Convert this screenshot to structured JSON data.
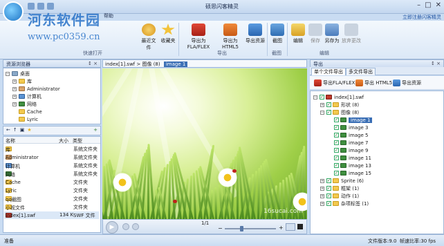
{
  "app": {
    "title": "硕思闪客精灵",
    "menu_text": "帮助",
    "register_link": "立即注册闪客精灵",
    "window_controls": [
      "–",
      "□",
      "✕"
    ]
  },
  "watermark": {
    "line1": "河东软件园",
    "line2": "www.pc0359.cn"
  },
  "ribbon": {
    "groups": [
      {
        "label": "快速打开",
        "buttons": [
          {
            "label": "最近文件"
          },
          {
            "label": "收藏夹"
          }
        ]
      },
      {
        "label": "导出",
        "buttons": [
          {
            "label": "导出为FLA/FLEX"
          },
          {
            "label": "导出为HTML5"
          },
          {
            "label": "导出资源"
          }
        ]
      },
      {
        "label": "截图",
        "buttons": [
          {
            "label": "截图"
          }
        ]
      },
      {
        "label": "编辑",
        "buttons": [
          {
            "label": "编辑"
          },
          {
            "label": "保存"
          },
          {
            "label": "另存为"
          },
          {
            "label": "放弃更改"
          }
        ]
      }
    ]
  },
  "left": {
    "header": "资源浏览器",
    "pin": "↕ ×",
    "tree": [
      {
        "label": "桌面",
        "icon": "desktop-icon",
        "depth": 0
      },
      {
        "label": "库",
        "icon": "library-icon",
        "depth": 1
      },
      {
        "label": "Administrator",
        "icon": "user-folder-icon",
        "depth": 1
      },
      {
        "label": "计算机",
        "icon": "computer-icon",
        "depth": 1
      },
      {
        "label": "网络",
        "icon": "network-icon",
        "depth": 1
      },
      {
        "label": "Cache",
        "icon": "folder-icon",
        "depth": 1
      },
      {
        "label": "Lyric",
        "icon": "folder-icon",
        "depth": 1
      }
    ],
    "list_columns": {
      "name": "名称",
      "size": "大小",
      "type": "类型"
    },
    "list": [
      {
        "name": "库",
        "size": "",
        "type": "系统文件夹"
      },
      {
        "name": "Administrator",
        "size": "",
        "type": "系统文件夹"
      },
      {
        "name": "计算机",
        "size": "",
        "type": "系统文件夹"
      },
      {
        "name": "网络",
        "size": "",
        "type": "系统文件夹"
      },
      {
        "name": "Cache",
        "size": "",
        "type": "文件夹"
      },
      {
        "name": "Lyric",
        "size": "",
        "type": "文件夹"
      },
      {
        "name": "qq截图",
        "size": "",
        "type": "文件夹"
      },
      {
        "name": "小视文件",
        "size": "",
        "type": "文件夹"
      },
      {
        "name": "index[1].swf",
        "size": "134 K",
        "type": "SWF 文件"
      }
    ]
  },
  "center": {
    "breadcrumb": {
      "file": "index[1].swf",
      "section": "图像 (8)",
      "item": "image 1"
    },
    "player": {
      "page": "1/1"
    },
    "stage_watermark": "16sucai.com"
  },
  "right": {
    "header": "导出",
    "tabs": [
      "单个文件导出",
      "多文件导出"
    ],
    "toolbar": [
      "导出FLA/FLEX",
      "导出 HTML5",
      "导出资源"
    ],
    "tree": [
      {
        "label": "index[1].swf",
        "depth": 0,
        "expander": "−"
      },
      {
        "label": "形状 (8)",
        "depth": 1,
        "expander": "+"
      },
      {
        "label": "图像 (8)",
        "depth": 1,
        "expander": "−"
      },
      {
        "label": "image 1",
        "depth": 2,
        "selected": true
      },
      {
        "label": "image 3",
        "depth": 2
      },
      {
        "label": "image 5",
        "depth": 2
      },
      {
        "label": "image 7",
        "depth": 2
      },
      {
        "label": "image 9",
        "depth": 2
      },
      {
        "label": "image 11",
        "depth": 2
      },
      {
        "label": "image 13",
        "depth": 2
      },
      {
        "label": "image 15",
        "depth": 2
      },
      {
        "label": "Sprite (6)",
        "depth": 1,
        "expander": "+"
      },
      {
        "label": "框架 (1)",
        "depth": 1,
        "expander": "+"
      },
      {
        "label": "动作 (1)",
        "depth": 1,
        "expander": "+"
      },
      {
        "label": "杂项标签 (1)",
        "depth": 1,
        "expander": "+"
      }
    ]
  },
  "status": {
    "left": "准备",
    "version": "文件版本:9.0",
    "rate": "帧速比率:30 fps"
  },
  "colors": {
    "accent": "#3b6fb5",
    "frame": "#c9dcf2",
    "border": "#9fb8d8"
  }
}
